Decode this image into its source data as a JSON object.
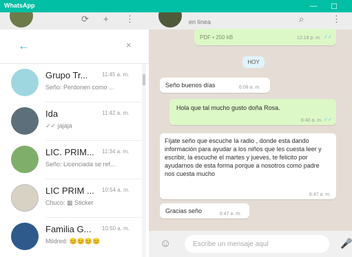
{
  "window": {
    "title": "WhatsApp",
    "minimize": "—",
    "maximize": "☐"
  },
  "left_header": {
    "icons": [
      "sync-icon",
      "add-icon",
      "menu-icon"
    ],
    "glyphs": [
      "⟳",
      "+",
      "⋮"
    ]
  },
  "search": {
    "back_glyph": "←",
    "clear_glyph": "×",
    "placeholder": ""
  },
  "chats": [
    {
      "name": "Grupo Tr...",
      "time": "11:45 a. m.",
      "preview": "Seño: Perdonen como ...",
      "avatar_color": "#9fd7e0"
    },
    {
      "name": "Ida",
      "time": "11:42 a. m.",
      "preview": "✓✓ jajaja",
      "avatar_color": "#5d6f7a"
    },
    {
      "name": "LIC. PRIM...",
      "time": "11:34 a. m.",
      "preview": "Seño: Licenciada se ref...",
      "avatar_color": "#7fae6a"
    },
    {
      "name": "LIC PRIM ...",
      "time": "10:54 a. m.",
      "preview": "Chuco: ▦ Sticker",
      "avatar_color": "#d8d2c4"
    },
    {
      "name": "Familia G...",
      "time": "10:50 a. m.",
      "preview": "Mildred: 😊😊😊😊",
      "avatar_color": "#2d5a8a"
    }
  ],
  "conversation": {
    "status": "en línea",
    "header_icons": [
      "search-icon",
      "menu-icon"
    ],
    "header_glyphs": [
      "⌕",
      "⋮"
    ],
    "date_label": "HOY",
    "messages": [
      {
        "dir": "out",
        "text": "PDF • 250 kB",
        "time": "12:18 p. m.",
        "ticks": "✓✓"
      },
      {
        "dir": "in",
        "text": "Seño buenos días",
        "time": "6:08 a. m."
      },
      {
        "dir": "out",
        "text": "Hola que tal mucho gusto doña Rosa.",
        "time": "6:40 a. m.",
        "ticks": "✓✓"
      },
      {
        "dir": "in",
        "text": "Fíjate seño que escuche la radio , donde esta dando información para ayudar a los niños que les cuesta leer y escribir, la escuche el martes y jueves, te felicito por ayudarnos de esta forma porque a nosotros como padre nos cuesta mucho",
        "time": "6:47 a. m."
      },
      {
        "dir": "in",
        "text": "Gracias seño",
        "time": "6:47 a. m."
      }
    ]
  },
  "composer": {
    "placeholder": "Escribe un mensaje aquí",
    "emoji_glyph": "☺",
    "mic_glyph": "🎤"
  },
  "colors": {
    "accent": "#00bfa5",
    "outgoing_bubble": "#dcf8c6",
    "incoming_bubble": "#ffffff",
    "chat_background": "#e5ddd5",
    "tick_read": "#4fc3f7"
  }
}
